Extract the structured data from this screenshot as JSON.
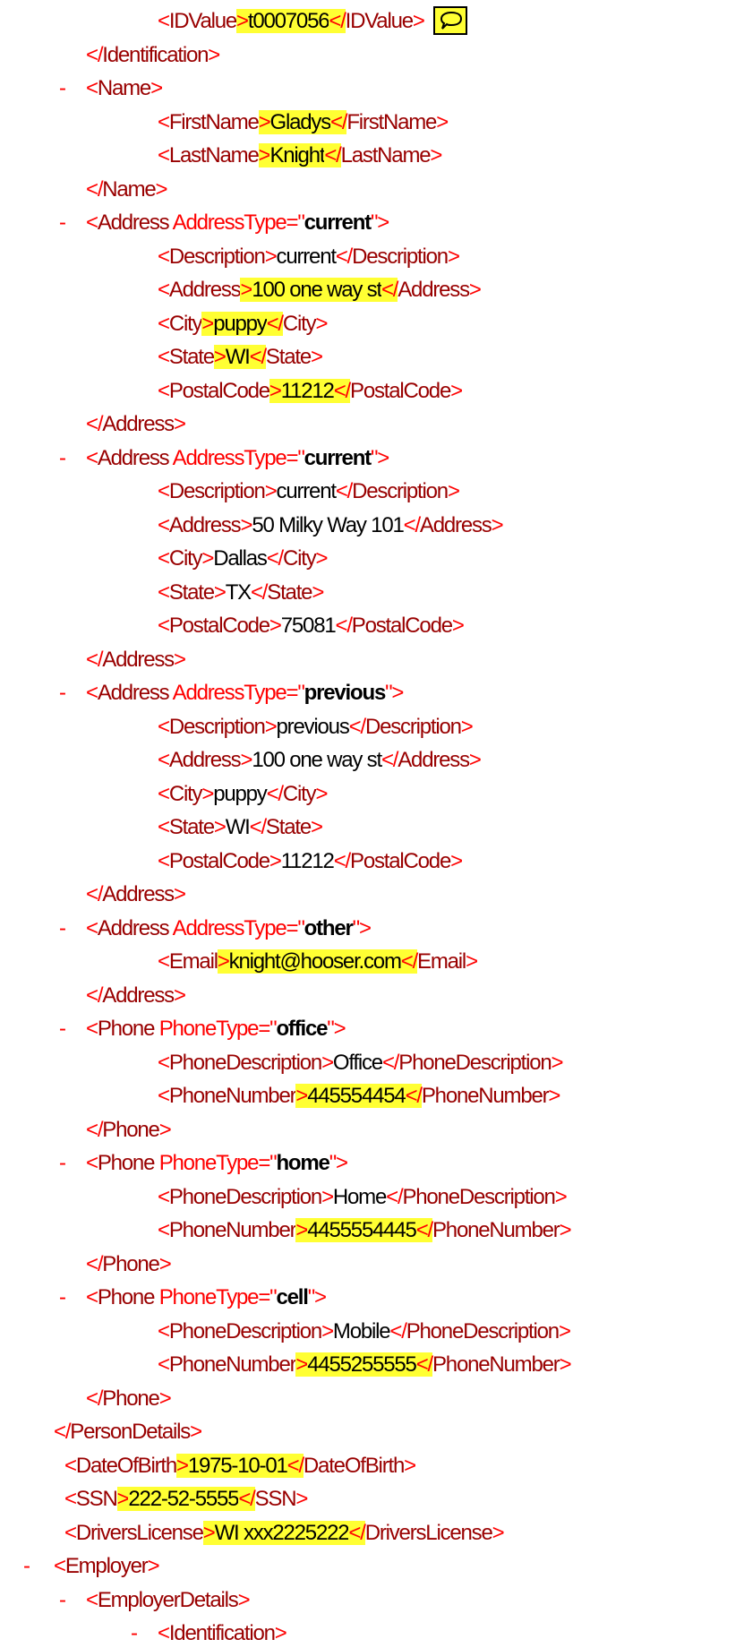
{
  "colors": {
    "bracket": "#ff0000",
    "tag_name": "#990000",
    "value": "#000000",
    "highlight": "#ffff33"
  },
  "collapse_symbol": "-",
  "lines": [
    {
      "indent": 3,
      "open": "IDValue",
      "value": "t0007056",
      "close": "IDValue",
      "hl": true,
      "icon": "comment-icon"
    },
    {
      "indent": 2,
      "close": "Identification"
    },
    {
      "indent": 2,
      "dash": true,
      "open": "Name"
    },
    {
      "indent": 3,
      "open": "FirstName",
      "value": "Gladys",
      "close": "FirstName",
      "hl": true
    },
    {
      "indent": 3,
      "open": "LastName",
      "value": "Knight",
      "close": "LastName",
      "hl": true
    },
    {
      "indent": 2,
      "close": "Name"
    },
    {
      "indent": 2,
      "dash": true,
      "open": "Address",
      "attr": "AddressType",
      "attrValue": "current"
    },
    {
      "indent": 3,
      "open": "Description",
      "value": "current",
      "close": "Description"
    },
    {
      "indent": 3,
      "open": "Address",
      "value": "100 one way st",
      "close": "Address",
      "hl": true
    },
    {
      "indent": 3,
      "open": "City",
      "value": "puppy",
      "close": "City",
      "hl": true
    },
    {
      "indent": 3,
      "open": "State",
      "value": "WI",
      "close": "State",
      "hl": true
    },
    {
      "indent": 3,
      "open": "PostalCode",
      "value": "11212",
      "close": "PostalCode",
      "hl": true
    },
    {
      "indent": 2,
      "close": "Address"
    },
    {
      "indent": 2,
      "dash": true,
      "open": "Address",
      "attr": "AddressType",
      "attrValue": "current"
    },
    {
      "indent": 3,
      "open": "Description",
      "value": "current",
      "close": "Description"
    },
    {
      "indent": 3,
      "open": "Address",
      "value": "50 Milky Way 101",
      "close": "Address"
    },
    {
      "indent": 3,
      "open": "City",
      "value": "Dallas",
      "close": "City"
    },
    {
      "indent": 3,
      "open": "State",
      "value": "TX",
      "close": "State"
    },
    {
      "indent": 3,
      "open": "PostalCode",
      "value": "75081",
      "close": "PostalCode"
    },
    {
      "indent": 2,
      "close": "Address"
    },
    {
      "indent": 2,
      "dash": true,
      "open": "Address",
      "attr": "AddressType",
      "attrValue": "previous"
    },
    {
      "indent": 3,
      "open": "Description",
      "value": "previous",
      "close": "Description"
    },
    {
      "indent": 3,
      "open": "Address",
      "value": "100 one way st",
      "close": "Address"
    },
    {
      "indent": 3,
      "open": "City",
      "value": "puppy",
      "close": "City"
    },
    {
      "indent": 3,
      "open": "State",
      "value": "WI",
      "close": "State"
    },
    {
      "indent": 3,
      "open": "PostalCode",
      "value": "11212",
      "close": "PostalCode"
    },
    {
      "indent": 2,
      "close": "Address"
    },
    {
      "indent": 2,
      "dash": true,
      "open": "Address",
      "attr": "AddressType",
      "attrValue": "other"
    },
    {
      "indent": 3,
      "open": "Email",
      "value": "knight@hooser.com",
      "close": "Email",
      "hl": true
    },
    {
      "indent": 2,
      "close": "Address"
    },
    {
      "indent": 2,
      "dash": true,
      "open": "Phone",
      "attr": "PhoneType",
      "attrValue": "office"
    },
    {
      "indent": 3,
      "open": "PhoneDescription",
      "value": "Office",
      "close": "PhoneDescription"
    },
    {
      "indent": 3,
      "open": "PhoneNumber",
      "value": "445554454",
      "close": "PhoneNumber",
      "hl": true
    },
    {
      "indent": 2,
      "close": "Phone"
    },
    {
      "indent": 2,
      "dash": true,
      "open": "Phone",
      "attr": "PhoneType",
      "attrValue": "home"
    },
    {
      "indent": 3,
      "open": "PhoneDescription",
      "value": "Home",
      "close": "PhoneDescription"
    },
    {
      "indent": 3,
      "open": "PhoneNumber",
      "value": "4455554445",
      "close": "PhoneNumber",
      "hl": true
    },
    {
      "indent": 2,
      "close": "Phone"
    },
    {
      "indent": 2,
      "dash": true,
      "open": "Phone",
      "attr": "PhoneType",
      "attrValue": "cell"
    },
    {
      "indent": 3,
      "open": "PhoneDescription",
      "value": "Mobile",
      "close": "PhoneDescription"
    },
    {
      "indent": 3,
      "open": "PhoneNumber",
      "value": "4455255555",
      "close": "PhoneNumber",
      "hl": true
    },
    {
      "indent": 2,
      "close": "Phone"
    },
    {
      "indent": 1,
      "close": "PersonDetails"
    },
    {
      "indent": 1.35,
      "open": "DateOfBirth",
      "value": "1975-10-01",
      "close": "DateOfBirth",
      "hl": true
    },
    {
      "indent": 1.35,
      "open": "SSN",
      "value": "222-52-5555",
      "close": "SSN",
      "hl": true
    },
    {
      "indent": 1.35,
      "open": "DriversLicense",
      "value": "WI xxx2225222",
      "close": "DriversLicense",
      "hl": true
    },
    {
      "indent": 1,
      "dash": true,
      "open": "Employer"
    },
    {
      "indent": 2,
      "dash": true,
      "open": "EmployerDetails"
    },
    {
      "indent": 3,
      "dash": true,
      "open": "Identification"
    }
  ]
}
